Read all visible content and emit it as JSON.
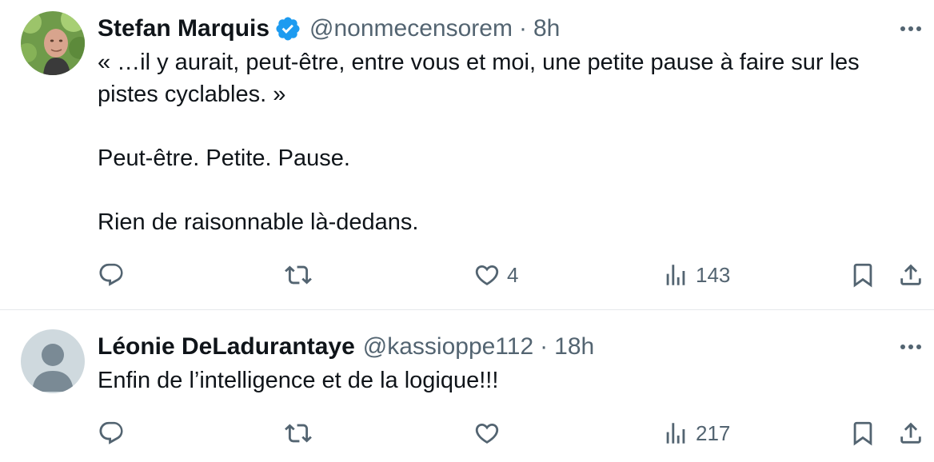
{
  "tweets": [
    {
      "display_name": "Stefan Marquis",
      "verified": true,
      "handle": "@nonmecensorem",
      "separator": "·",
      "time": "8h",
      "text": [
        "« …il y aurait, peut-être, entre vous et moi, une petite pause à faire sur les pistes cyclables. »",
        "Peut-être. Petite. Pause.",
        "Rien de raisonnable là-dedans."
      ],
      "likes": "4",
      "views": "143"
    },
    {
      "display_name": "Léonie DeLadurantaye",
      "verified": false,
      "handle": "@kassioppe112",
      "separator": "·",
      "time": "18h",
      "text": [
        "Enfin de l’intelligence et de la logique!!!"
      ],
      "likes": "",
      "views": "217"
    }
  ],
  "icons": {
    "reply": "reply-icon",
    "retweet": "retweet-icon",
    "like": "heart-icon",
    "views": "views-icon",
    "bookmark": "bookmark-icon",
    "share": "share-icon",
    "more": "more-icon",
    "verified": "verified-icon"
  },
  "colors": {
    "text": "#0f1419",
    "secondary": "#536471",
    "verified": "#1d9bf0",
    "divider": "#e6e9eb"
  }
}
